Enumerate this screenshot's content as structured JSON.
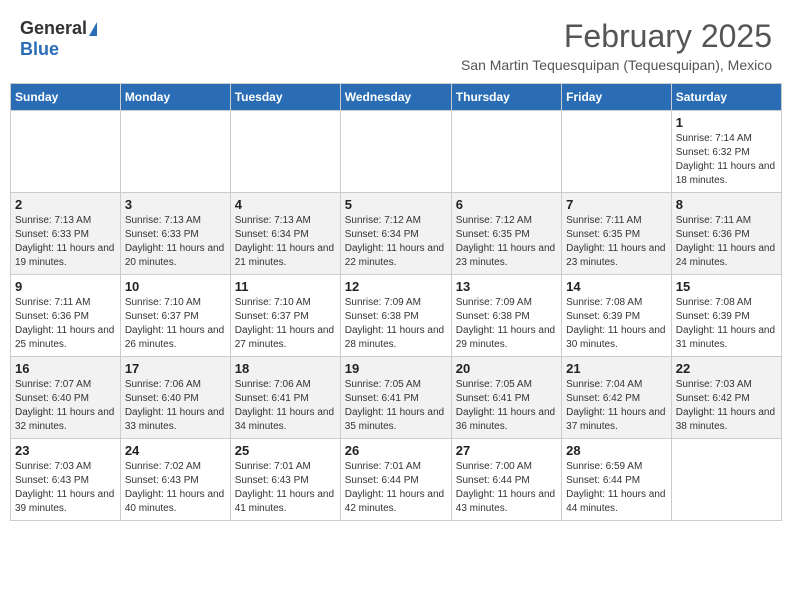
{
  "header": {
    "logo_general": "General",
    "logo_blue": "Blue",
    "month_year": "February 2025",
    "subtitle": "San Martin Tequesquipan (Tequesquipan), Mexico"
  },
  "days_of_week": [
    "Sunday",
    "Monday",
    "Tuesday",
    "Wednesday",
    "Thursday",
    "Friday",
    "Saturday"
  ],
  "weeks": [
    [
      {
        "day": "",
        "info": ""
      },
      {
        "day": "",
        "info": ""
      },
      {
        "day": "",
        "info": ""
      },
      {
        "day": "",
        "info": ""
      },
      {
        "day": "",
        "info": ""
      },
      {
        "day": "",
        "info": ""
      },
      {
        "day": "1",
        "info": "Sunrise: 7:14 AM\nSunset: 6:32 PM\nDaylight: 11 hours and 18 minutes."
      }
    ],
    [
      {
        "day": "2",
        "info": "Sunrise: 7:13 AM\nSunset: 6:33 PM\nDaylight: 11 hours and 19 minutes."
      },
      {
        "day": "3",
        "info": "Sunrise: 7:13 AM\nSunset: 6:33 PM\nDaylight: 11 hours and 20 minutes."
      },
      {
        "day": "4",
        "info": "Sunrise: 7:13 AM\nSunset: 6:34 PM\nDaylight: 11 hours and 21 minutes."
      },
      {
        "day": "5",
        "info": "Sunrise: 7:12 AM\nSunset: 6:34 PM\nDaylight: 11 hours and 22 minutes."
      },
      {
        "day": "6",
        "info": "Sunrise: 7:12 AM\nSunset: 6:35 PM\nDaylight: 11 hours and 23 minutes."
      },
      {
        "day": "7",
        "info": "Sunrise: 7:11 AM\nSunset: 6:35 PM\nDaylight: 11 hours and 23 minutes."
      },
      {
        "day": "8",
        "info": "Sunrise: 7:11 AM\nSunset: 6:36 PM\nDaylight: 11 hours and 24 minutes."
      }
    ],
    [
      {
        "day": "9",
        "info": "Sunrise: 7:11 AM\nSunset: 6:36 PM\nDaylight: 11 hours and 25 minutes."
      },
      {
        "day": "10",
        "info": "Sunrise: 7:10 AM\nSunset: 6:37 PM\nDaylight: 11 hours and 26 minutes."
      },
      {
        "day": "11",
        "info": "Sunrise: 7:10 AM\nSunset: 6:37 PM\nDaylight: 11 hours and 27 minutes."
      },
      {
        "day": "12",
        "info": "Sunrise: 7:09 AM\nSunset: 6:38 PM\nDaylight: 11 hours and 28 minutes."
      },
      {
        "day": "13",
        "info": "Sunrise: 7:09 AM\nSunset: 6:38 PM\nDaylight: 11 hours and 29 minutes."
      },
      {
        "day": "14",
        "info": "Sunrise: 7:08 AM\nSunset: 6:39 PM\nDaylight: 11 hours and 30 minutes."
      },
      {
        "day": "15",
        "info": "Sunrise: 7:08 AM\nSunset: 6:39 PM\nDaylight: 11 hours and 31 minutes."
      }
    ],
    [
      {
        "day": "16",
        "info": "Sunrise: 7:07 AM\nSunset: 6:40 PM\nDaylight: 11 hours and 32 minutes."
      },
      {
        "day": "17",
        "info": "Sunrise: 7:06 AM\nSunset: 6:40 PM\nDaylight: 11 hours and 33 minutes."
      },
      {
        "day": "18",
        "info": "Sunrise: 7:06 AM\nSunset: 6:41 PM\nDaylight: 11 hours and 34 minutes."
      },
      {
        "day": "19",
        "info": "Sunrise: 7:05 AM\nSunset: 6:41 PM\nDaylight: 11 hours and 35 minutes."
      },
      {
        "day": "20",
        "info": "Sunrise: 7:05 AM\nSunset: 6:41 PM\nDaylight: 11 hours and 36 minutes."
      },
      {
        "day": "21",
        "info": "Sunrise: 7:04 AM\nSunset: 6:42 PM\nDaylight: 11 hours and 37 minutes."
      },
      {
        "day": "22",
        "info": "Sunrise: 7:03 AM\nSunset: 6:42 PM\nDaylight: 11 hours and 38 minutes."
      }
    ],
    [
      {
        "day": "23",
        "info": "Sunrise: 7:03 AM\nSunset: 6:43 PM\nDaylight: 11 hours and 39 minutes."
      },
      {
        "day": "24",
        "info": "Sunrise: 7:02 AM\nSunset: 6:43 PM\nDaylight: 11 hours and 40 minutes."
      },
      {
        "day": "25",
        "info": "Sunrise: 7:01 AM\nSunset: 6:43 PM\nDaylight: 11 hours and 41 minutes."
      },
      {
        "day": "26",
        "info": "Sunrise: 7:01 AM\nSunset: 6:44 PM\nDaylight: 11 hours and 42 minutes."
      },
      {
        "day": "27",
        "info": "Sunrise: 7:00 AM\nSunset: 6:44 PM\nDaylight: 11 hours and 43 minutes."
      },
      {
        "day": "28",
        "info": "Sunrise: 6:59 AM\nSunset: 6:44 PM\nDaylight: 11 hours and 44 minutes."
      },
      {
        "day": "",
        "info": ""
      }
    ]
  ]
}
